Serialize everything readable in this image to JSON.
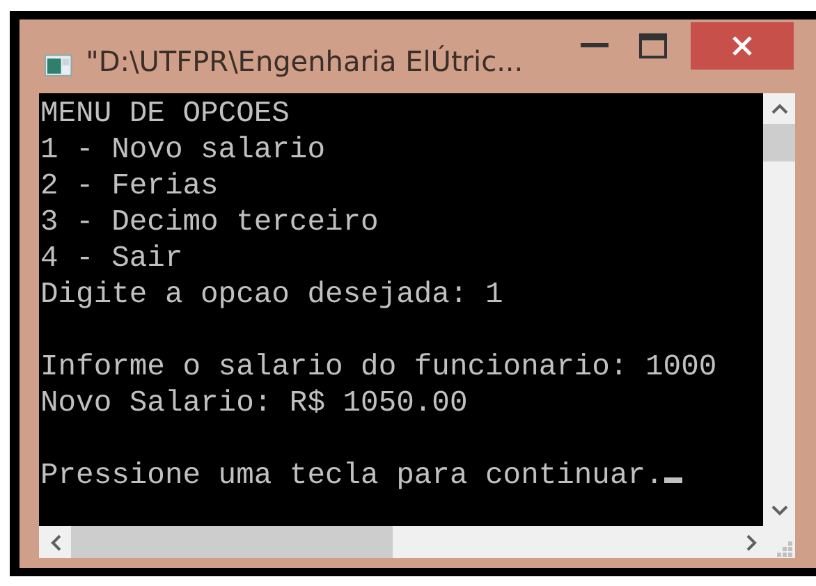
{
  "window": {
    "title": "\"D:\\UTFPR\\Engenharia ElÚtric..."
  },
  "console": {
    "blocks": [
      [
        "MENU DE OPCOES",
        "1 - Novo salario",
        "2 - Ferias",
        "3 - Decimo terceiro",
        "4 - Sair",
        "Digite a opcao desejada: 1"
      ],
      [
        "Informe o salario do funcionario: 1000",
        "Novo Salario: R$ 1050.00"
      ],
      [
        "Pressione uma tecla para continuar."
      ]
    ],
    "cursor_visible": true
  }
}
